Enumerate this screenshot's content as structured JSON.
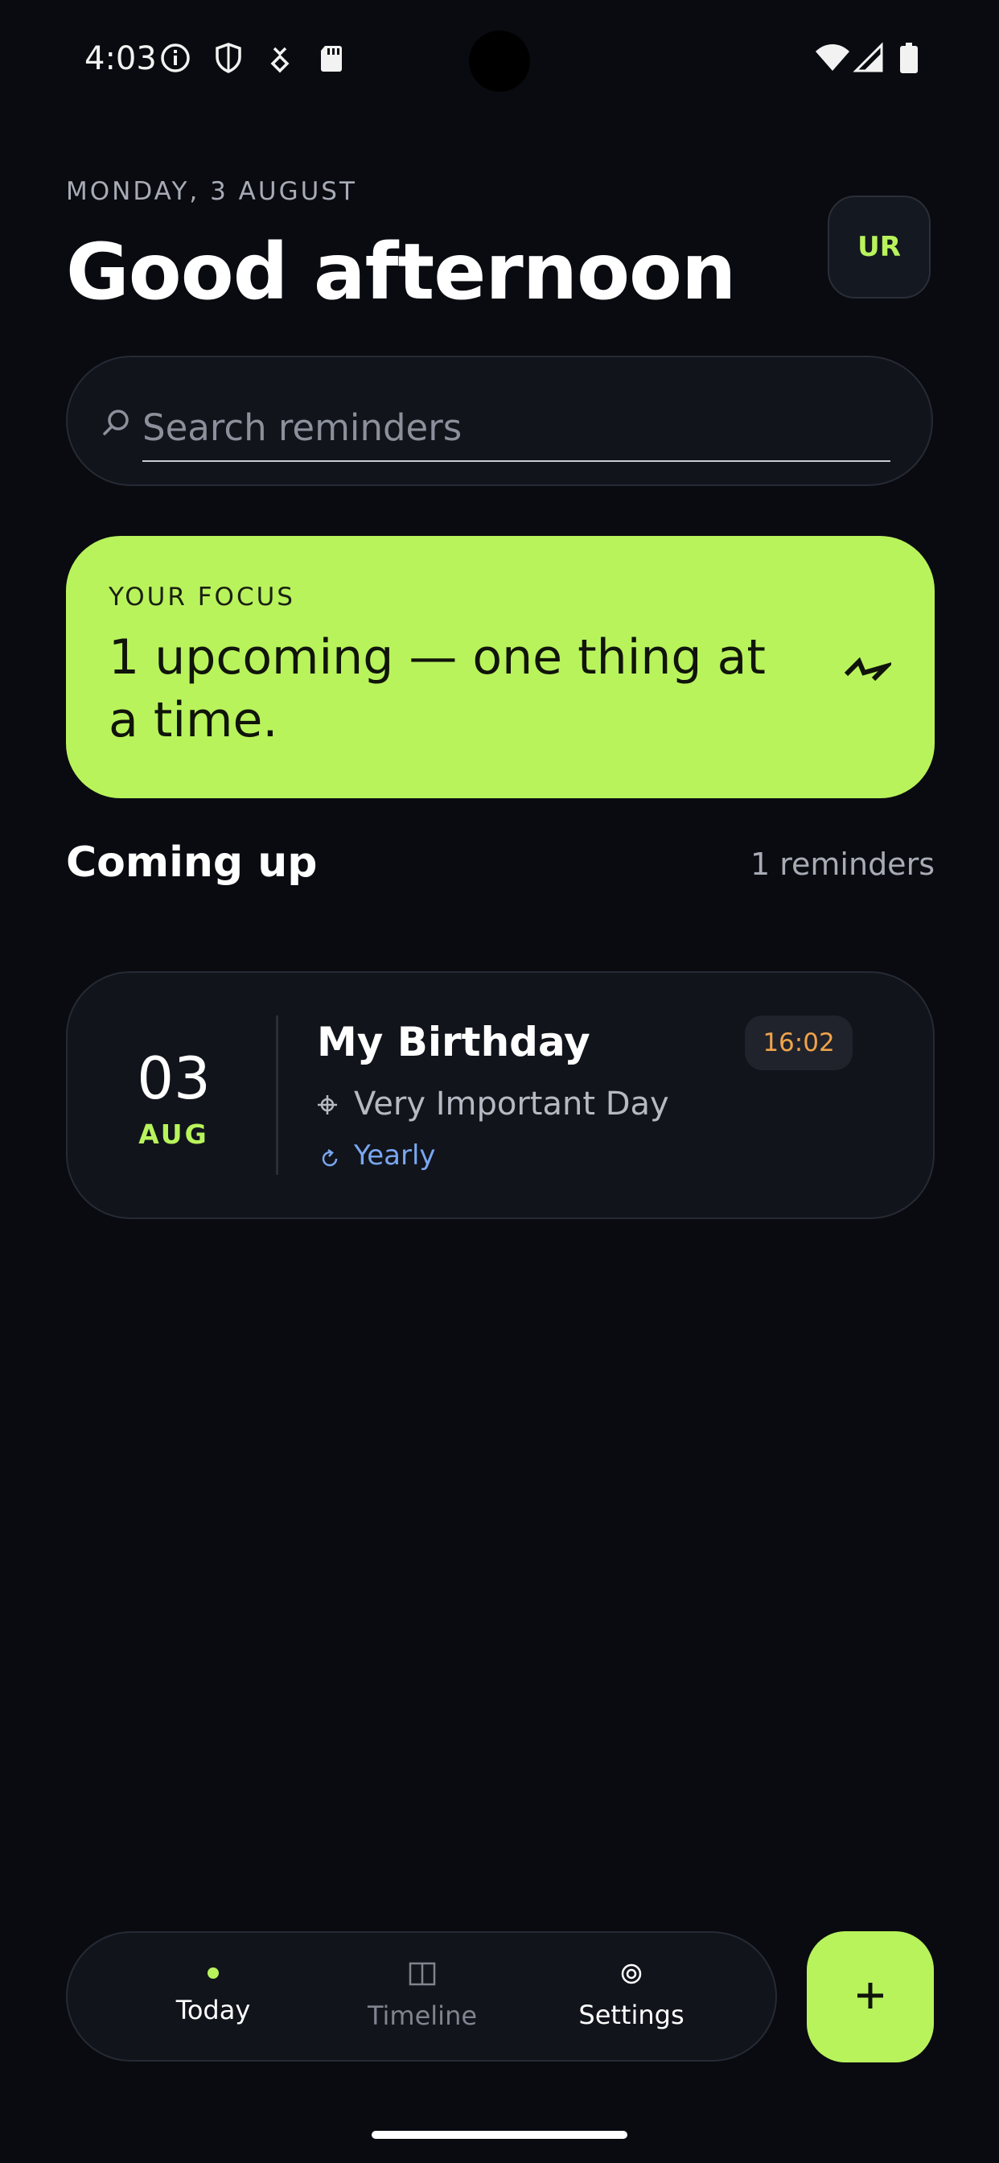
{
  "status_bar": {
    "time": "4:03"
  },
  "header": {
    "date": "MONDAY, 3 AUGUST",
    "greeting": "Good afternoon",
    "avatar_initials": "UR"
  },
  "search": {
    "placeholder": "Search reminders",
    "value": ""
  },
  "focus": {
    "label": "YOUR FOCUS",
    "text": "1 upcoming — one thing at a time."
  },
  "section": {
    "title": "Coming up",
    "count": "1 reminders"
  },
  "reminders": [
    {
      "day": "03",
      "month": "AUG",
      "title": "My Birthday",
      "time": "16:02",
      "note": "Very Important Day",
      "repeat": "Yearly"
    }
  ],
  "nav": {
    "items": [
      {
        "label": "Today",
        "active": true
      },
      {
        "label": "Timeline",
        "active": false
      },
      {
        "label": "Settings",
        "active": false
      }
    ]
  },
  "colors": {
    "accent": "#b8f35c",
    "background": "#0a0b10",
    "card": "#11141b",
    "time_badge_text": "#f0a34b",
    "repeat_text": "#7aa7f0"
  },
  "icons": {
    "search": "search-icon",
    "focus": "bolt-icon",
    "note": "note-icon",
    "repeat": "repeat-icon",
    "timeline": "timeline-icon",
    "settings": "settings-icon",
    "add": "plus-icon"
  }
}
